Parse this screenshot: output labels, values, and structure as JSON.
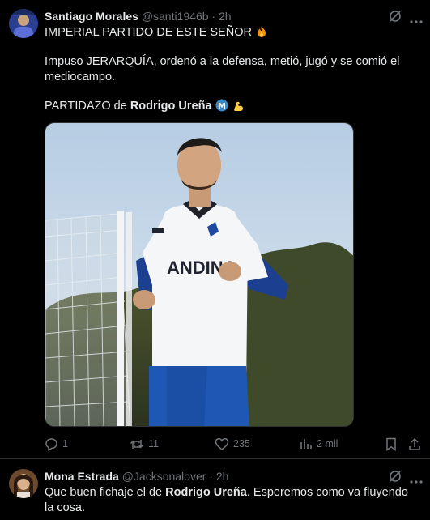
{
  "tweet1": {
    "author_name": "Santiago Morales",
    "handle": "@santi1946b",
    "separator": "·",
    "time": "2h",
    "lines": {
      "l1": "IMPERIAL PARTIDO DE ESTE SEÑOR",
      "l1_emoji": "fire-emoji",
      "l2": "Impuso JERARQUÍA, ordenó a la defensa, metió, jugó y se comió el mediocampo.",
      "l3_prefix": "PARTIDAZO de ",
      "l3_bold": "Rodrigo Ureña",
      "l3_emoji1": "club-badge-emoji",
      "l3_emoji2": "flexed-biceps-emoji"
    },
    "media": {
      "shirt_text": "ANDINA"
    },
    "actions": {
      "replies": "1",
      "reposts": "11",
      "likes": "235",
      "views": "2 mil"
    }
  },
  "tweet2": {
    "author_name": "Mona Estrada",
    "handle": "@Jacksonalover",
    "separator": "·",
    "time": "2h",
    "text_prefix": "Que buen fichaje el de ",
    "text_bold": "Rodrigo Ureña",
    "text_suffix": ". Esperemos como va fluyendo la cosa."
  },
  "colors": {
    "background": "#000000",
    "primary_text": "#e7e9ea",
    "secondary_text": "#71767b",
    "divider": "#2f3336"
  }
}
